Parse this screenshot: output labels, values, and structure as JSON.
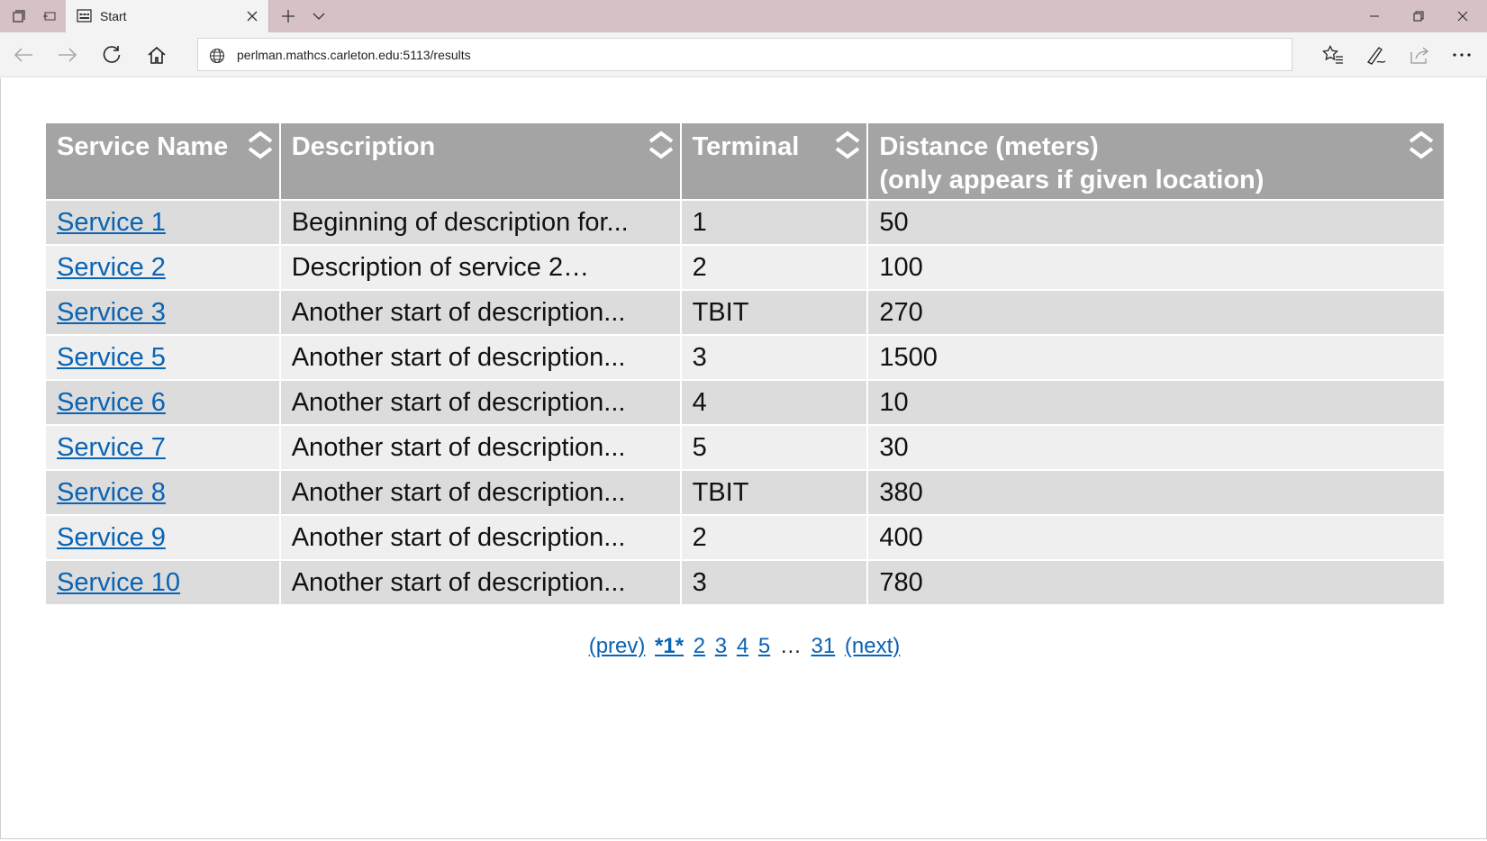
{
  "browser": {
    "tab_title": "Start",
    "url": "perlman.mathcs.carleton.edu:5113/results"
  },
  "table": {
    "headers": {
      "service_name": "Service Name",
      "description": "Description",
      "terminal": "Terminal",
      "distance_line1": "Distance (meters)",
      "distance_line2": "(only appears if given location)"
    },
    "rows": [
      {
        "service": "Service 1",
        "description": "Beginning of description for...",
        "terminal": "1",
        "distance": "50"
      },
      {
        "service": "Service 2",
        "description": "Description of service 2…",
        "terminal": "2",
        "distance": "100"
      },
      {
        "service": "Service 3",
        "description": "Another start of description...",
        "terminal": "TBIT",
        "distance": "270"
      },
      {
        "service": "Service 5",
        "description": "Another start of description...",
        "terminal": "3",
        "distance": "1500"
      },
      {
        "service": "Service 6",
        "description": "Another start of description...",
        "terminal": "4",
        "distance": "10"
      },
      {
        "service": "Service 7",
        "description": "Another start of description...",
        "terminal": "5",
        "distance": "30"
      },
      {
        "service": "Service 8",
        "description": "Another start of description...",
        "terminal": "TBIT",
        "distance": "380"
      },
      {
        "service": "Service 9",
        "description": "Another start of description...",
        "terminal": "2",
        "distance": "400"
      },
      {
        "service": "Service 10",
        "description": "Another start of description...",
        "terminal": "3",
        "distance": "780"
      }
    ]
  },
  "pager": {
    "prev": "(prev)",
    "current": "*1*",
    "pages": [
      "2",
      "3",
      "4",
      "5"
    ],
    "ellipsis": "…",
    "last": "31",
    "next": "(next)"
  },
  "colors": {
    "header_bg": "#a4a4a4",
    "row_odd": "#dcdcdc",
    "row_even": "#efefef",
    "link": "#0a63b3",
    "titlebar": "#d6c2c4"
  }
}
